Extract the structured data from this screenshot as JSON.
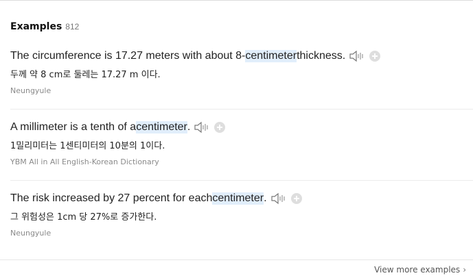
{
  "header": {
    "title": "Examples",
    "count": "812"
  },
  "examples": [
    {
      "pre": "The circumference is 17.27 meters with about 8-",
      "highlight": "centimeter",
      "post": " thickness.",
      "translation": "두께 약 8 cm로 둘레는 17.27 m 이다.",
      "source": "Neungyule"
    },
    {
      "pre": "A millimeter is a tenth of a ",
      "highlight": "centimeter",
      "post": ".",
      "translation": "1밀리미터는 1센티미터의 10분의 1이다.",
      "source": "YBM All in All English-Korean Dictionary"
    },
    {
      "pre": "The risk increased by 27 percent for each ",
      "highlight": "centimeter",
      "post": ".",
      "translation": "그 위험성은 1cm 당 27%로 증가한다.",
      "source": "Neungyule"
    }
  ],
  "footer": {
    "more_label": "View more examples",
    "chevron": "›"
  },
  "icons": {
    "speaker": "speaker-icon",
    "add": "plus-circle-icon"
  },
  "colors": {
    "highlight": "#e1eefb",
    "source_text": "#8a8a8a",
    "add_button": "#dedede"
  }
}
